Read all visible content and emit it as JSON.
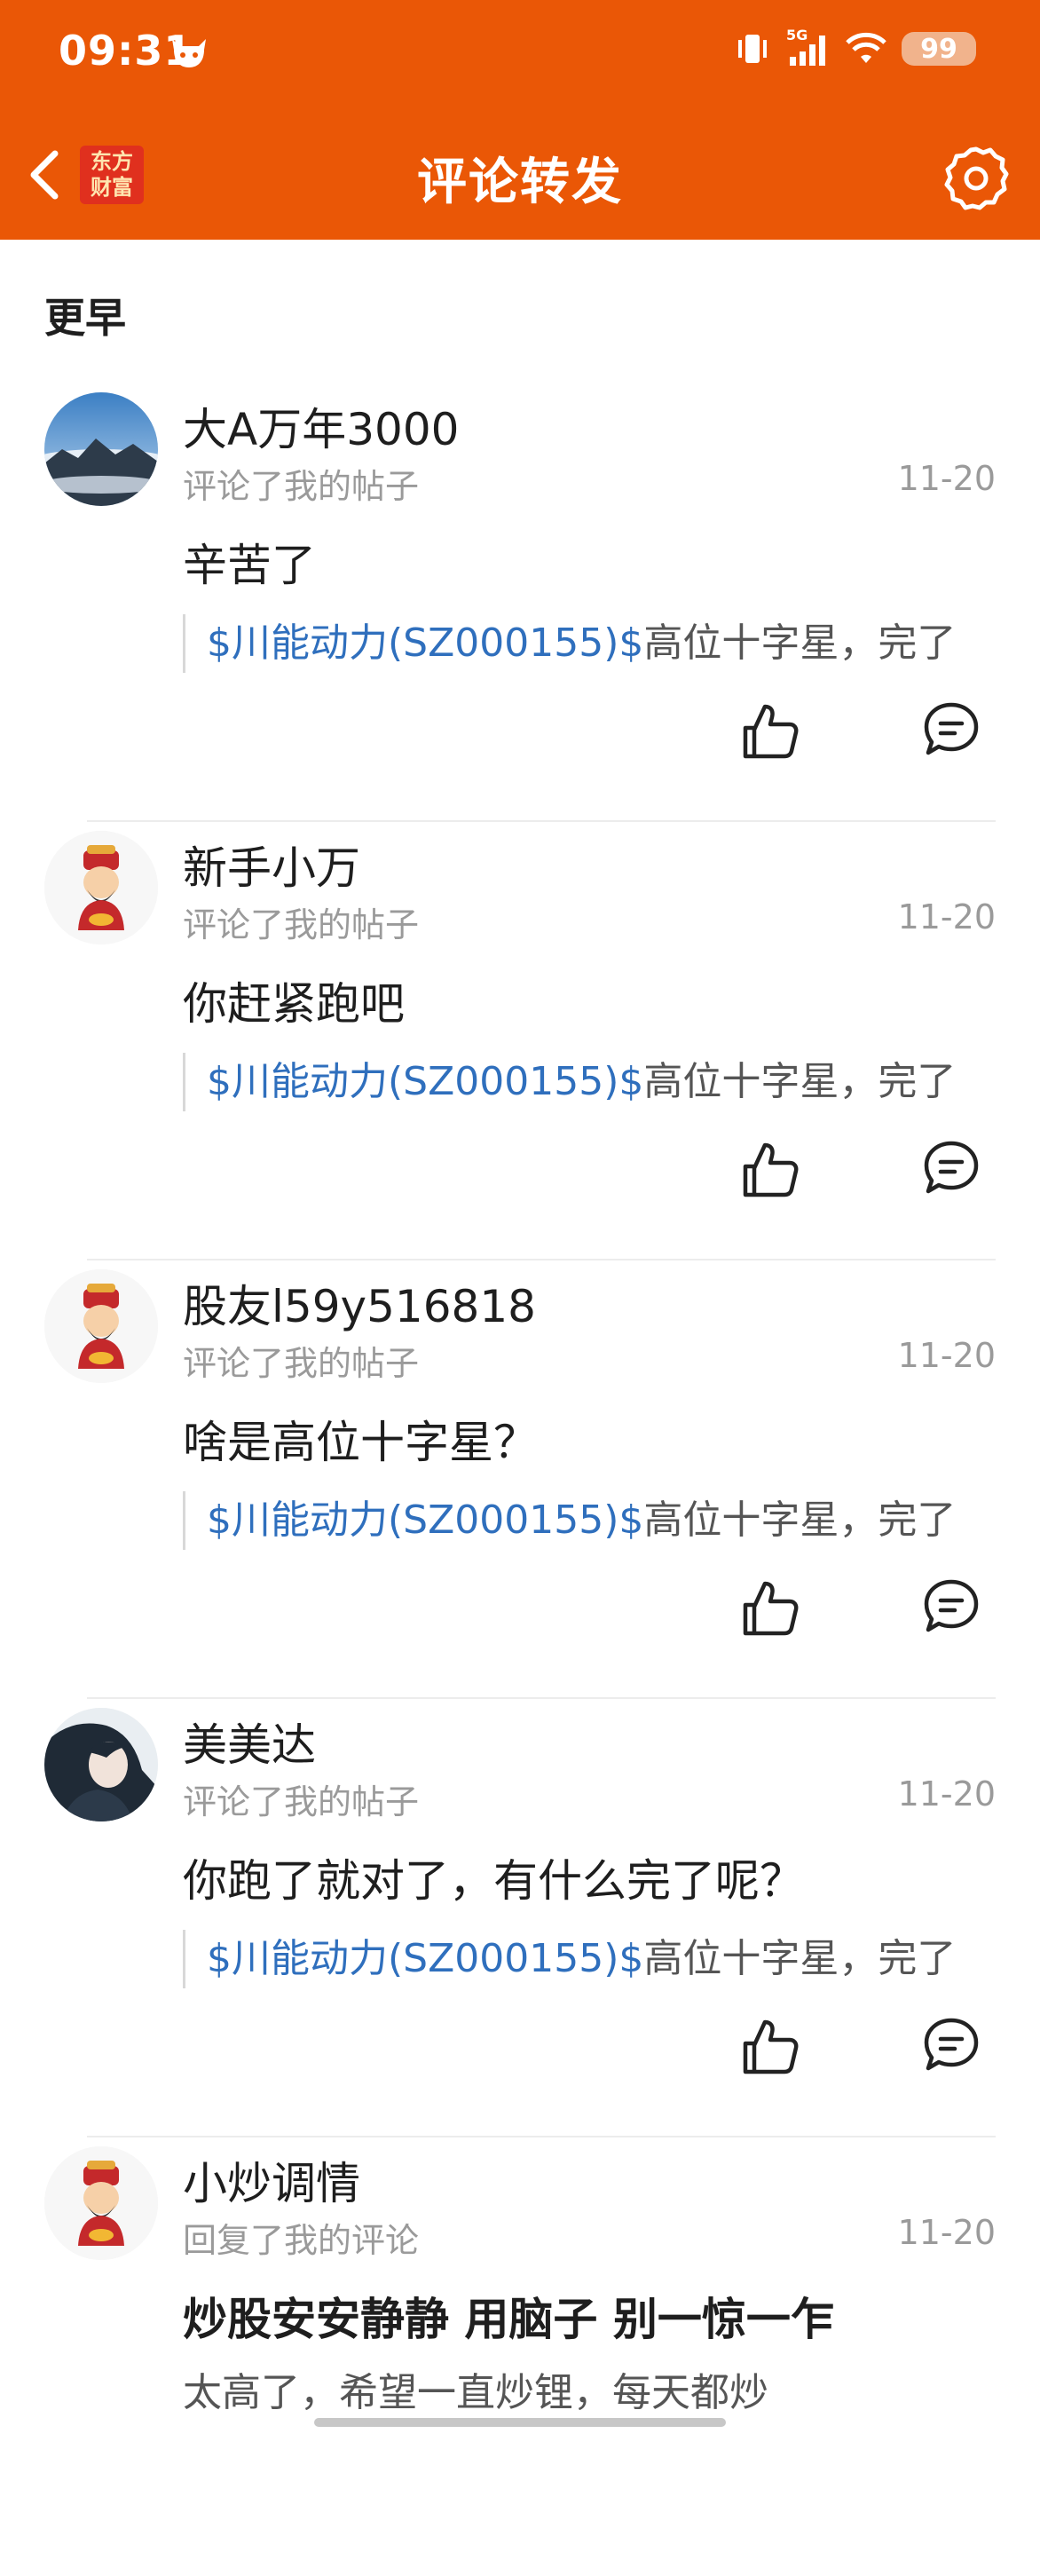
{
  "status_bar": {
    "time": "09:31",
    "network": "5G",
    "battery": "99"
  },
  "header": {
    "title": "评论转发",
    "logo_line1": "东方",
    "logo_line2": "财富"
  },
  "section": {
    "title": "更早"
  },
  "notifications": [
    {
      "username": "大A万年3000",
      "action": "评论了我的帖子",
      "date": "11-20",
      "comment": "辛苦了",
      "quote_stock": "$川能动力(SZ000155)$",
      "quote_text": "高位十字星，完了",
      "avatar": "mountain-landscape"
    },
    {
      "username": "新手小万",
      "action": "评论了我的帖子",
      "date": "11-20",
      "comment": "你赶紧跑吧",
      "quote_stock": "$川能动力(SZ000155)$",
      "quote_text": "高位十字星，完了",
      "avatar": "fortune-god"
    },
    {
      "username": "股友l59y516818",
      "action": "评论了我的帖子",
      "date": "11-20",
      "comment": "啥是高位十字星？",
      "quote_stock": "$川能动力(SZ000155)$",
      "quote_text": "高位十字星，完了",
      "avatar": "fortune-god"
    },
    {
      "username": "美美达",
      "action": "评论了我的帖子",
      "date": "11-20",
      "comment": "你跑了就对了，有什么完了呢？",
      "quote_stock": "$川能动力(SZ000155)$",
      "quote_text": "高位十字星，完了",
      "avatar": "person-photo"
    },
    {
      "username": "小炒调情",
      "action": "回复了我的评论",
      "date": "11-20",
      "comment": "炒股安安静静 用脑子  别一惊一乍",
      "quote_stock": "",
      "quote_text": "太高了，希望一直炒锂，每天都炒",
      "avatar": "fortune-god"
    }
  ],
  "colors": {
    "header": "#ea5706",
    "stock_link": "#2f6fbd",
    "secondary_text": "#9a9a9a"
  }
}
